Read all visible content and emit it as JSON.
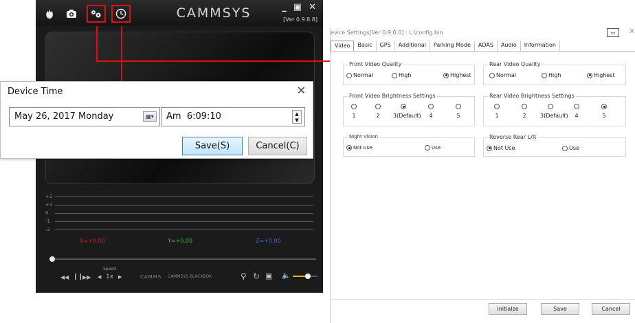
{
  "player": {
    "brand": "CAMMSYS",
    "version": "[Ver 0.9.8.8]",
    "graph_ticks": [
      "+2",
      "+1",
      "0",
      "-1",
      "-2"
    ],
    "axes": {
      "x": "X=+0.00",
      "y": "Y=+0.00",
      "z": "Z=+0.00",
      "x_color": "#d12020",
      "y_color": "#3dbb3d",
      "z_color": "#4a6bd8"
    },
    "speed_label": "Speed",
    "speed_value": "1x",
    "footer_brand": "CAMMS",
    "footer_text": "CAMMSYS BLACKBOX",
    "volume_fraction": 0.6
  },
  "device_time": {
    "title": "Device Time",
    "date_value": "May 26, 2017 Monday",
    "time_value": "Am  6:09:10",
    "save_label": "Save(S)",
    "cancel_label": "Cancel(C)"
  },
  "device_settings": {
    "title": "evice Settings[Ver 0.9.0.0] : L:\\config.bin",
    "tabs": [
      "Video",
      "Basic",
      "GPS",
      "Additional",
      "Parking Mode",
      "ADAS",
      "Audio",
      "Information"
    ],
    "front_quality": {
      "title": "Front Video Quality",
      "options": [
        "Normal",
        "High",
        "Highest"
      ],
      "selected": 2
    },
    "rear_quality": {
      "title": "Rear Video Quality",
      "options": [
        "Normal",
        "High",
        "Highest"
      ],
      "selected": 2
    },
    "front_brightness": {
      "title": "Front Video Brightness Settings",
      "levels": [
        "1",
        "2",
        "3(Default)",
        "4",
        "5"
      ],
      "selected": 2
    },
    "rear_brightness": {
      "title": "Rear Video Brightness Settings",
      "levels": [
        "1",
        "2",
        "3(Default)",
        "4",
        "5"
      ],
      "selected": 4
    },
    "night_vision": {
      "title": "Night Vision",
      "options": [
        "Not Use",
        "Use"
      ],
      "selected": 0
    },
    "reverse_rear": {
      "title": "Reverse Rear L/R",
      "options": [
        "Not Use",
        "Use"
      ],
      "selected": 0
    },
    "buttons": {
      "initialize": "Initialze",
      "save": "Save",
      "cancel": "Cancel"
    }
  }
}
